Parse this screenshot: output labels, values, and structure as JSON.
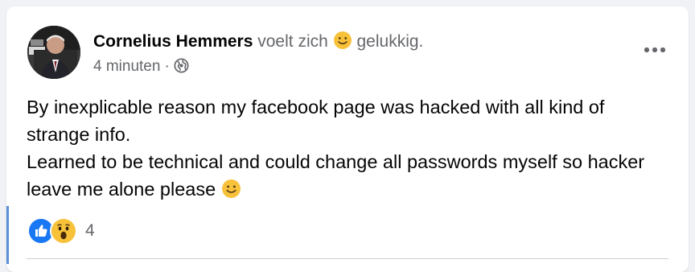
{
  "post": {
    "author_name": "Cornelius Hemmers",
    "feeling_prefix": "voelt zich",
    "feeling_word": "gelukkig.",
    "feeling_icon": "slightly-smiling-face-icon",
    "timestamp": "4 minuten",
    "separator": "·",
    "privacy_icon": "globe-icon",
    "more_icon": "more-options-icon",
    "text_lines": [
      "By inexplicable reason my facebook page was hacked with all kind of strange info.",
      "Learned to be technical and could change all passwords myself so hacker leave me alone please"
    ],
    "text_end_icon": "slightly-smiling-face-icon"
  },
  "reactions": {
    "icons": [
      "like-icon",
      "wow-icon"
    ],
    "count": "4"
  },
  "colors": {
    "name": "#050505",
    "secondary": "#65676b",
    "like_blue": "#1877f2",
    "emoji_yellow": "#f7c23a",
    "accent_bar": "#5b8fd6"
  }
}
